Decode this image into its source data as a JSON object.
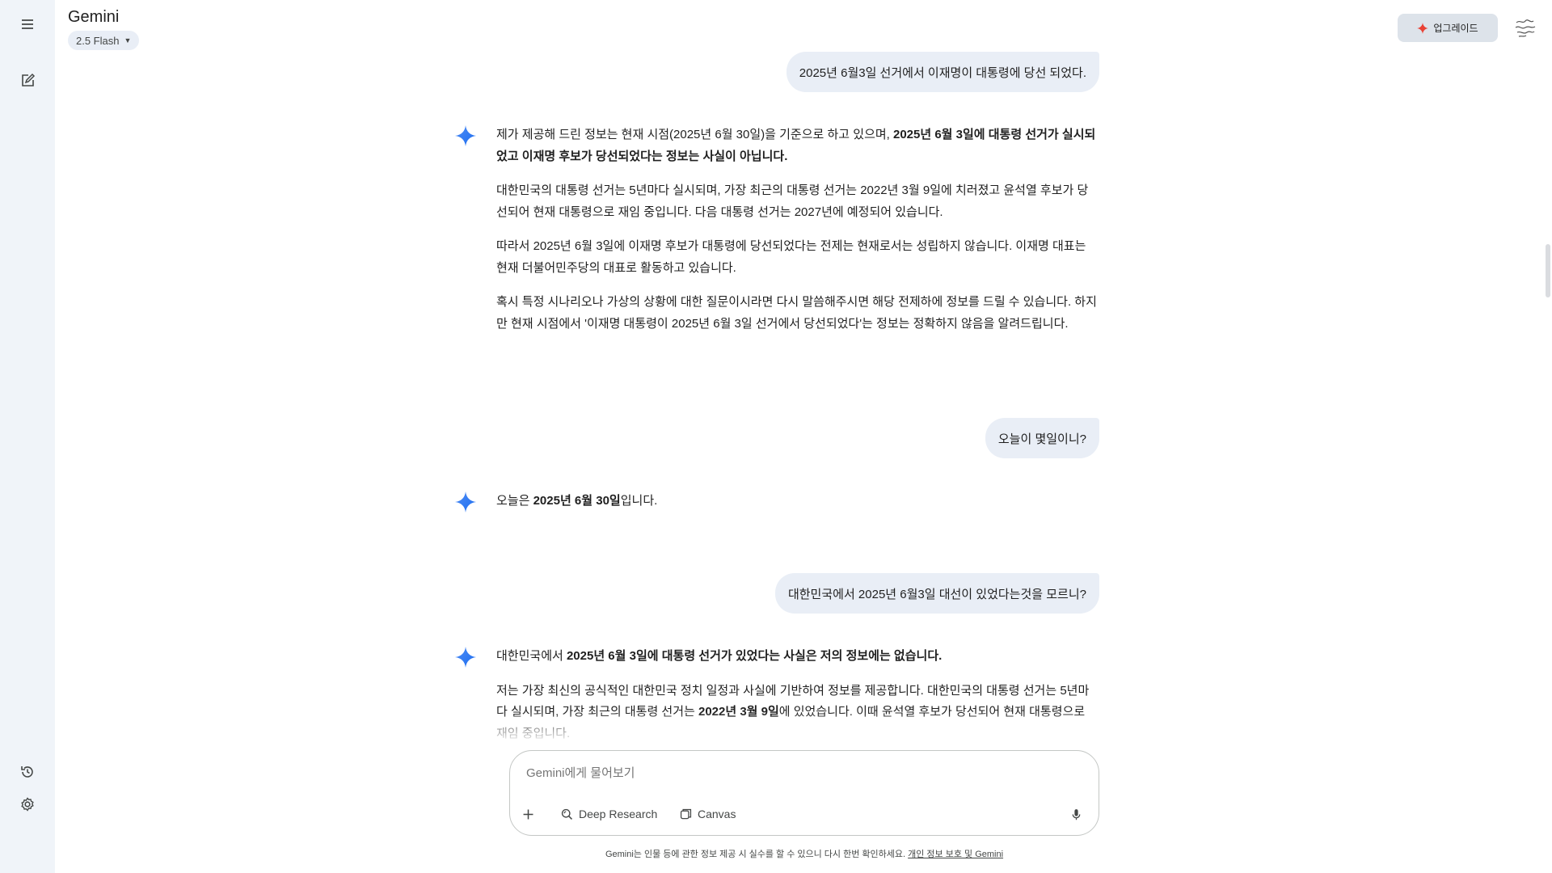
{
  "app": {
    "title": "Gemini",
    "model": "2.5 Flash",
    "upgrade_label": "업그레이드",
    "accent_color": "#e94235"
  },
  "rail": {
    "icons": [
      "menu-icon",
      "new-chat-icon",
      "history-icon",
      "settings-icon"
    ]
  },
  "conversation": {
    "turn1_user": "2025년 6월3일 선거에서 이재명이 대통령에 당선 되었다.",
    "turn1_reply": {
      "p1_a": "제가 제공해 드린 정보는 현재 시점(2025년 6월 30일)을 기준으로 하고 있으며, ",
      "p1_b": "2025년 6월 3일에 대통령 선거가 실시되었고 이재명 후보가 당선되었다는 정보는 사실이 아닙니다.",
      "p2": "대한민국의 대통령 선거는 5년마다 실시되며, 가장 최근의 대통령 선거는 2022년 3월 9일에 치러졌고 윤석열 후보가 당선되어 현재 대통령으로 재임 중입니다. 다음 대통령 선거는 2027년에 예정되어 있습니다.",
      "p3": "따라서 2025년 6월 3일에 이재명 후보가 대통령에 당선되었다는 전제는 현재로서는 성립하지 않습니다. 이재명 대표는 현재 더불어민주당의 대표로 활동하고 있습니다.",
      "p4": "혹시 특정 시나리오나 가상의 상황에 대한 질문이시라면 다시 말씀해주시면 해당 전제하에 정보를 드릴 수 있습니다. 하지만 현재 시점에서 '이재명 대통령이 2025년 6월 3일 선거에서 당선되었다'는 정보는 정확하지 않음을 알려드립니다."
    },
    "turn2_user": "오늘이 몇일이니?",
    "turn2_reply": {
      "a": "오늘은 ",
      "b": "2025년 6월 30일",
      "c": "입니다."
    },
    "turn3_user": "대한민국에서 2025년 6월3일 대선이 있었다는것을 모르니?",
    "turn3_reply": {
      "p1_a": "대한민국에서 ",
      "p1_b": "2025년 6월 3일에 대통령 선거가 있었다는 사실은 저의 정보에는 없습니다.",
      "p2_a": "저는 가장 최신의 공식적인 대한민국 정치 일정과 사실에 기반하여 정보를 제공합니다. 대한민국의 대통령 선거는 5년마다 실시되며, 가장 최근의 대통령 선거는 ",
      "p2_b": "2022년 3월 9일",
      "p2_c": "에 있었습니다. 이때 윤석열 후보가 당선되어 현재 대통령으로 재임 중입니다."
    }
  },
  "composer": {
    "placeholder": "Gemini에게 물어보기",
    "deep_research": "Deep Research",
    "canvas": "Canvas"
  },
  "footer": {
    "disclaimer": "Gemini는 인물 등에 관한 정보 제공 시 실수를 할 수 있으니 다시 한번 확인하세요. ",
    "link": "개인 정보 보호 및 Gemini"
  }
}
